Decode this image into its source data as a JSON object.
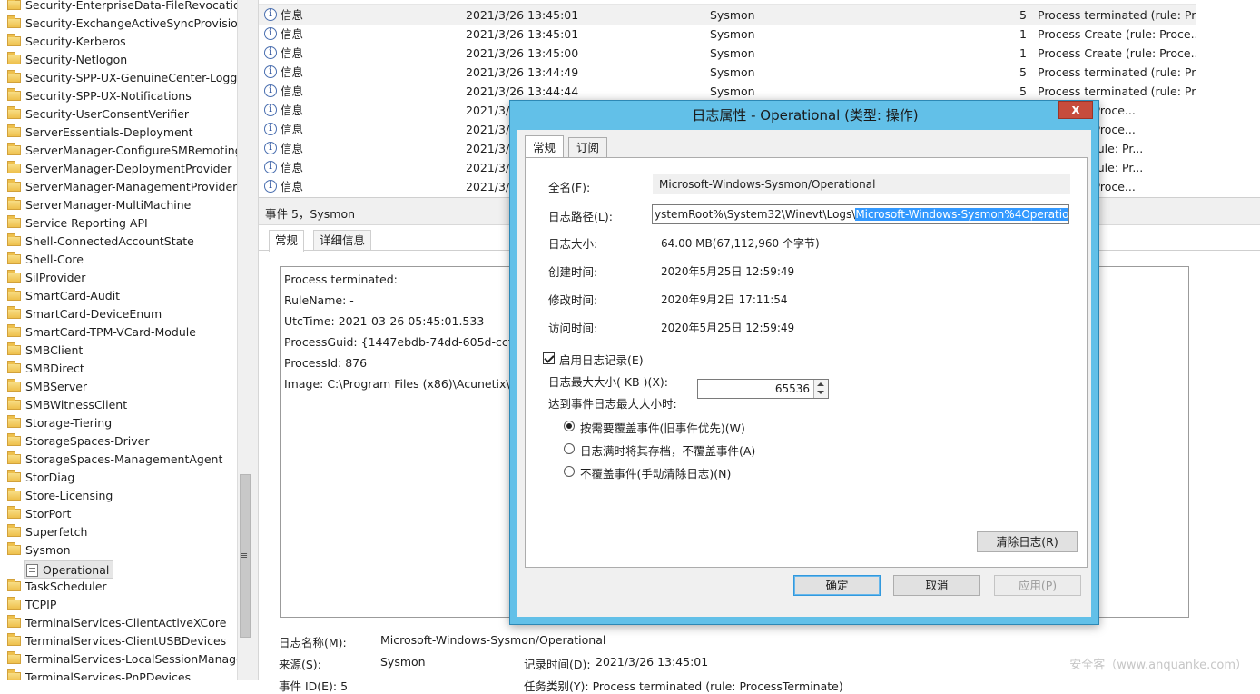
{
  "tree": {
    "items": [
      "Security-EnterpriseData-FileRevocationManager",
      "Security-ExchangeActiveSyncProvisioning",
      "Security-Kerberos",
      "Security-Netlogon",
      "Security-SPP-UX-GenuineCenter-Logging",
      "Security-SPP-UX-Notifications",
      "Security-UserConsentVerifier",
      "ServerEssentials-Deployment",
      "ServerManager-ConfigureSMRemoting",
      "ServerManager-DeploymentProvider",
      "ServerManager-ManagementProvider",
      "ServerManager-MultiMachine",
      "Service Reporting API",
      "Shell-ConnectedAccountState",
      "Shell-Core",
      "SilProvider",
      "SmartCard-Audit",
      "SmartCard-DeviceEnum",
      "SmartCard-TPM-VCard-Module",
      "SMBClient",
      "SMBDirect",
      "SMBServer",
      "SMBWitnessClient",
      "Storage-Tiering",
      "StorageSpaces-Driver",
      "StorageSpaces-ManagementAgent",
      "StorDiag",
      "Store-Licensing",
      "StorPort",
      "Superfetch",
      "Sysmon",
      "",
      "TaskScheduler",
      "TCPIP",
      "TerminalServices-ClientActiveXCore",
      "TerminalServices-ClientUSBDevices",
      "TerminalServices-LocalSessionManager",
      "TerminalServices-PnPDevices"
    ],
    "selected_child": "Operational",
    "grip": "≡"
  },
  "events": [
    {
      "level": "信息",
      "date": "2021/3/26 13:45:01",
      "source": "Sysmon",
      "id": "5",
      "task": "Process terminated (rule: Pr..."
    },
    {
      "level": "信息",
      "date": "2021/3/26 13:45:01",
      "source": "Sysmon",
      "id": "1",
      "task": "Process Create (rule: Proce..."
    },
    {
      "level": "信息",
      "date": "2021/3/26 13:45:00",
      "source": "Sysmon",
      "id": "1",
      "task": "Process Create (rule: Proce..."
    },
    {
      "level": "信息",
      "date": "2021/3/26 13:44:49",
      "source": "Sysmon",
      "id": "5",
      "task": "Process terminated (rule: Pr..."
    },
    {
      "level": "信息",
      "date": "2021/3/26 13:44:44",
      "source": "Sysmon",
      "id": "5",
      "task": "Process terminated (rule: Pr..."
    },
    {
      "level": "信息",
      "date": "2021/3/2",
      "source": "",
      "id": "",
      "task": "ate (rule: Proce..."
    },
    {
      "level": "信息",
      "date": "2021/3/2",
      "source": "",
      "id": "",
      "task": "ate (rule: Proce..."
    },
    {
      "level": "信息",
      "date": "2021/3/2",
      "source": "",
      "id": "",
      "task": "minated (rule: Pr..."
    },
    {
      "level": "信息",
      "date": "2021/3/2",
      "source": "",
      "id": "",
      "task": "minated (rule: Pr..."
    },
    {
      "level": "信息",
      "date": "2021/3/2",
      "source": "",
      "id": "",
      "task": "ate (rule: Proce..."
    }
  ],
  "detail": {
    "title": "事件 5，Sysmon",
    "tabs": [
      "常规",
      "详细信息"
    ],
    "lines": [
      "Process terminated:",
      "RuleName: -",
      "UtcTime: 2021-03-26 05:45:01.533",
      "ProcessGuid: {1447ebdb-74dd-605d-ccf5-0",
      "ProcessId: 876",
      "Image: C:\\Program Files (x86)\\Acunetix\\pgV"
    ],
    "log_name_label": "日志名称(M):",
    "log_name_value": "Microsoft-Windows-Sysmon/Operational",
    "source_label": "来源(S):",
    "source_value": "Sysmon",
    "logged_label": "记录时间(D):",
    "logged_value": "2021/3/26 13:45:01",
    "row3_partial": "事件 ID(E):    5",
    "row3_task_partial": "任务类别(Y):    Process terminated (rule: ProcessTerminate)"
  },
  "watermark": "安全客（www.anquanke.com）",
  "dialog": {
    "title": "日志属性 - Operational (类型: 操作)",
    "close": "x",
    "tabs": [
      "常规",
      "订阅"
    ],
    "full_name_label": "全名(F):",
    "full_name_value": "Microsoft-Windows-Sysmon/Operational",
    "log_path_label": "日志路径(L):",
    "log_path_plain": "ystemRoot%\\System32\\Winevt\\Logs\\",
    "log_path_selected": "Microsoft-Windows-Sysmon%4Operational.evtx",
    "log_size_label": "日志大小:",
    "log_size_value": "64.00 MB(67,112,960 个字节)",
    "created_label": "创建时间:",
    "created_value": "2020年5月25日 12:59:49",
    "modified_label": "修改时间:",
    "modified_value": "2020年9月2日 17:11:54",
    "accessed_label": "访问时间:",
    "accessed_value": "2020年5月25日 12:59:49",
    "enable_label": "启用日志记录(E)",
    "max_size_label": "日志最大大小( KB )(X):",
    "max_size_value": "65536",
    "when_max_label": "达到事件日志最大大小时:",
    "options": [
      "按需要覆盖事件(旧事件优先)(W)",
      "日志满时将其存档，不覆盖事件(A)",
      "不覆盖事件(手动清除日志)(N)"
    ],
    "selected_option": 0,
    "clear_button": "清除日志(R)",
    "ok_button": "确定",
    "cancel_button": "取消",
    "apply_button": "应用(P)"
  }
}
